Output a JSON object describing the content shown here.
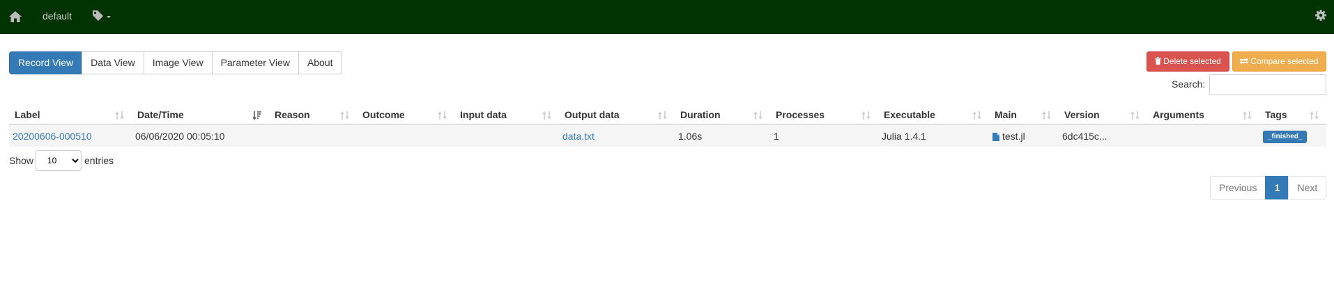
{
  "navbar": {
    "home_icon": "home-icon",
    "project": "default",
    "tags_icon": "tag-icon",
    "settings_icon": "gear-icon"
  },
  "tabs": [
    {
      "label": "Record View",
      "active": true
    },
    {
      "label": "Data View",
      "active": false
    },
    {
      "label": "Image View",
      "active": false
    },
    {
      "label": "Parameter View",
      "active": false
    },
    {
      "label": "About",
      "active": false
    }
  ],
  "actions": {
    "delete_label": "Delete selected",
    "compare_label": "Compare selected"
  },
  "search": {
    "label": "Search:",
    "value": ""
  },
  "table": {
    "columns": [
      "Label",
      "Date/Time",
      "Reason",
      "Outcome",
      "Input data",
      "Output data",
      "Duration",
      "Processes",
      "Executable",
      "Main",
      "Version",
      "Arguments",
      "Tags"
    ],
    "sorted_column": "Date/Time",
    "rows": [
      {
        "label": "20200606-000510",
        "datetime": "06/06/2020 00:05:10",
        "reason": "",
        "outcome": "",
        "input_data": "",
        "output_data": "data.txt",
        "duration": "1.06s",
        "processes": "1",
        "executable": "Julia 1.4.1",
        "main": "test.jl",
        "version": "6dc415c...",
        "arguments": "",
        "tags": "_finished_"
      }
    ]
  },
  "entries": {
    "show_label": "Show",
    "selected": "10",
    "entries_label": "entries"
  },
  "pagination": {
    "previous": "Previous",
    "current": "1",
    "next": "Next"
  },
  "colors": {
    "navbar": "#003300",
    "primary": "#337ab7",
    "danger": "#d9534f",
    "warning": "#f0ad4e"
  }
}
